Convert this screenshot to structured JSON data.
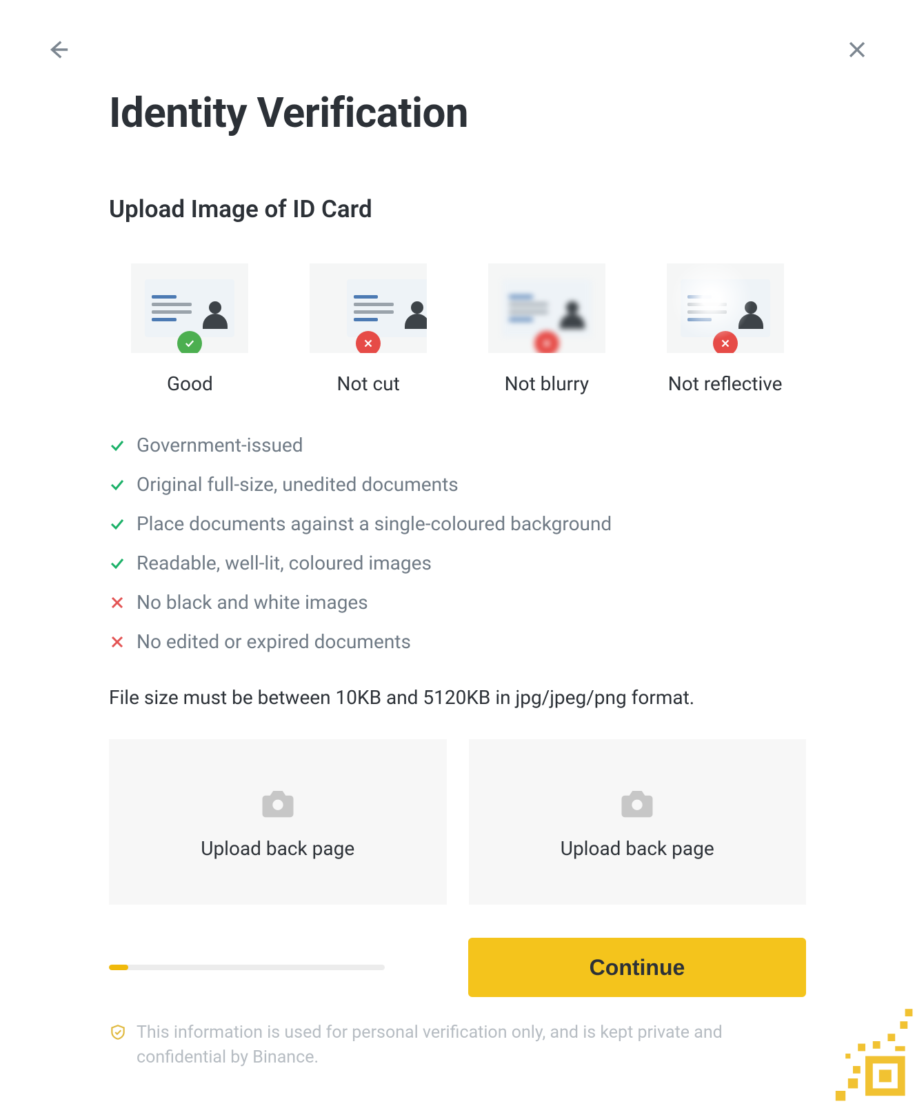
{
  "header": {
    "title": "Identity Verification",
    "subtitle": "Upload Image of ID Card"
  },
  "examples": {
    "good": "Good",
    "not_cut": "Not cut",
    "not_blurry": "Not blurry",
    "not_reflective": "Not reflective"
  },
  "requirements": [
    {
      "ok": true,
      "text": "Government-issued"
    },
    {
      "ok": true,
      "text": "Original full-size, unedited documents"
    },
    {
      "ok": true,
      "text": "Place documents against a single-coloured background"
    },
    {
      "ok": true,
      "text": "Readable, well-lit, coloured images"
    },
    {
      "ok": false,
      "text": "No black and white images"
    },
    {
      "ok": false,
      "text": "No edited or expired documents"
    }
  ],
  "file_note": "File size must be between 10KB and 5120KB in jpg/jpeg/png format.",
  "upload": {
    "left_label": "Upload back page",
    "right_label": "Upload back page"
  },
  "progress_percent": 7,
  "continue_label": "Continue",
  "privacy_text": "This information is used for personal verification only, and is kept private and confidential by Binance."
}
